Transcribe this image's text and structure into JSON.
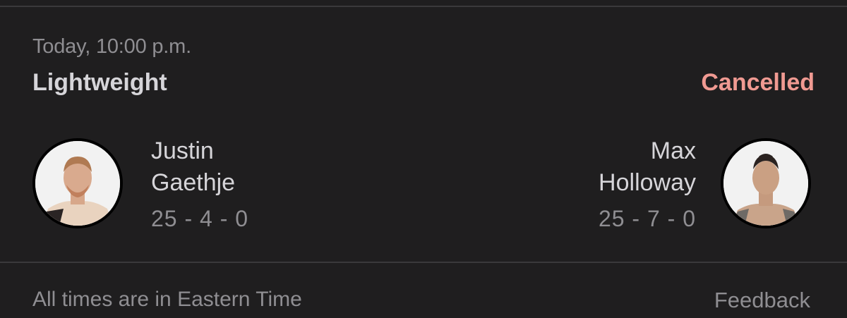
{
  "event": {
    "datetime": "Today, 10:00 p.m.",
    "weight_class": "Lightweight",
    "status": "Cancelled",
    "status_color": "#f09a92"
  },
  "fighters": [
    {
      "first_name": "Justin",
      "last_name": "Gaethje",
      "record": "25 - 4 - 0",
      "avatar_icon": "fighter-photo"
    },
    {
      "first_name": "Max",
      "last_name": "Holloway",
      "record": "25 - 7 - 0",
      "avatar_icon": "fighter-photo"
    }
  ],
  "footer": {
    "note": "All times are in Eastern Time",
    "feedback_label": "Feedback"
  },
  "theme": {
    "background": "#1f1e1f",
    "primary_text": "#d6d5d9",
    "secondary_text": "#8f8e92"
  }
}
